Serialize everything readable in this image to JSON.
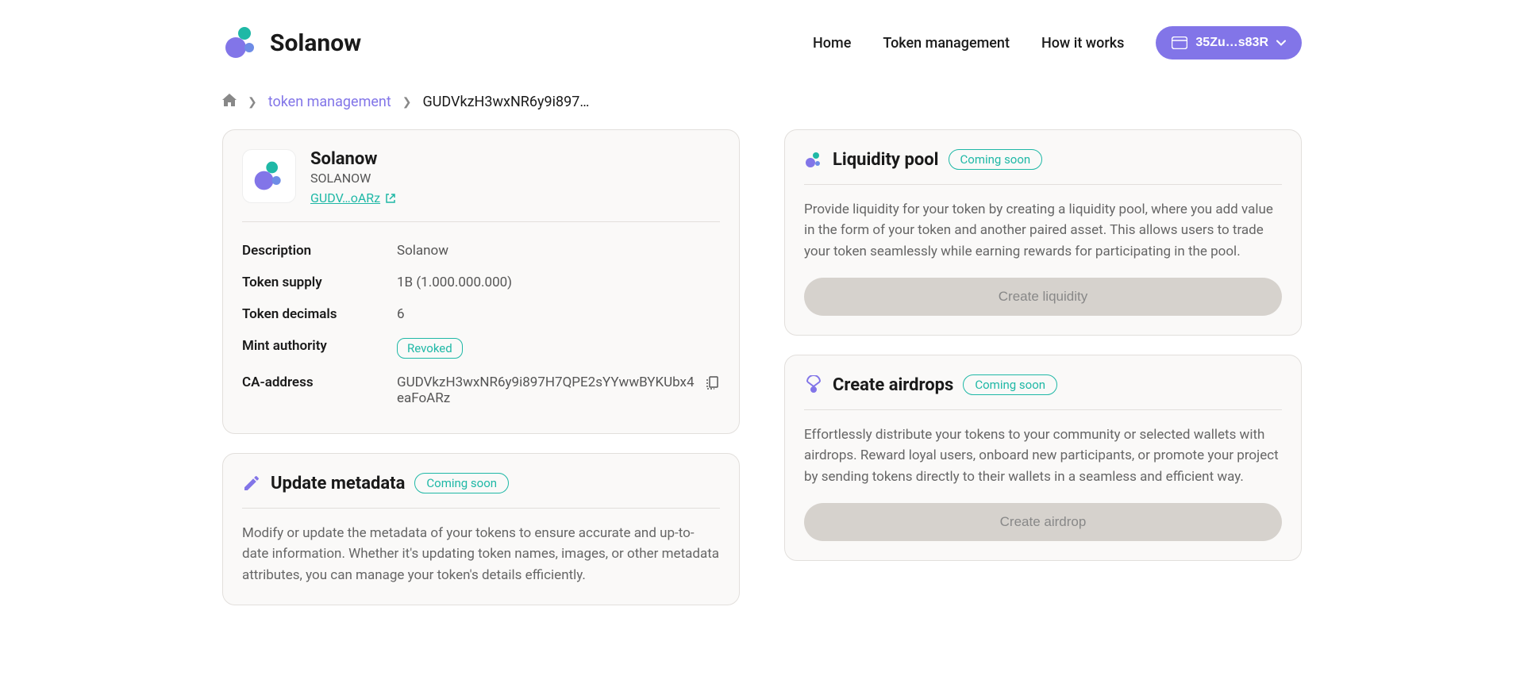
{
  "header": {
    "brand": "Solanow",
    "nav": {
      "home": "Home",
      "token_mgmt": "Token management",
      "how_it_works": "How it works"
    },
    "wallet_label": "35Zu…s83R"
  },
  "breadcrumb": {
    "link1": "token management",
    "current": "GUDVkzH3wxNR6y9i897…"
  },
  "token": {
    "name": "Solanow",
    "symbol": "SOLANOW",
    "link_short": "GUDV…oARz",
    "details": {
      "description_label": "Description",
      "description_value": "Solanow",
      "supply_label": "Token supply",
      "supply_value": "1B (1.000.000.000)",
      "decimals_label": "Token decimals",
      "decimals_value": "6",
      "mint_label": "Mint authority",
      "mint_badge": "Revoked",
      "ca_label": "CA-address",
      "ca_value": "GUDVkzH3wxNR6y9i897H7QPE2sYYwwBYKUbx4eaFoARz"
    }
  },
  "sections": {
    "update_metadata": {
      "title": "Update metadata",
      "badge": "Coming soon",
      "desc": "Modify or update the metadata of your tokens to ensure accurate and up-to-date information. Whether it's updating token names, images, or other metadata attributes, you can manage your token's details efficiently."
    },
    "liquidity": {
      "title": "Liquidity pool",
      "badge": "Coming soon",
      "desc": "Provide liquidity for your token by creating a liquidity pool, where you add value in the form of your token and another paired asset. This allows users to trade your token seamlessly while earning rewards for participating in the pool.",
      "button": "Create liquidity"
    },
    "airdrops": {
      "title": "Create airdrops",
      "badge": "Coming soon",
      "desc": "Effortlessly distribute your tokens to your community or selected wallets with airdrops. Reward loyal users, onboard new participants, or promote your project by sending tokens directly to their wallets in a seamless and efficient way.",
      "button": "Create airdrop"
    }
  }
}
